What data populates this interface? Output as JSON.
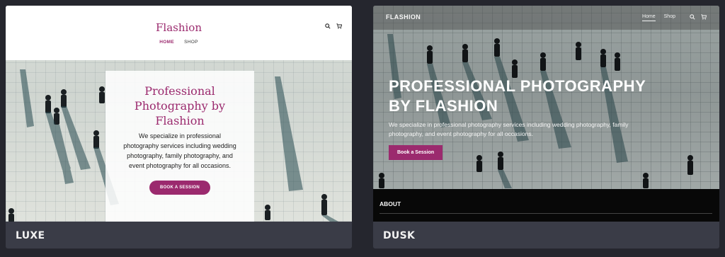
{
  "themes": [
    {
      "label": "LUXE",
      "brand": "Flashion",
      "nav": [
        "HOME",
        "SHOP"
      ],
      "hero_title": "Professional Photography by Flashion",
      "hero_text": "We specialize in professional photography services including wedding photography, family photography, and event photography for all occasions.",
      "cta": "BOOK A SESSION",
      "accent_color": "#9b2a6e",
      "icons": [
        "search-icon",
        "cart-icon"
      ]
    },
    {
      "label": "DUSK",
      "brand": "FLASHION",
      "nav": [
        "Home",
        "Shop"
      ],
      "hero_title": "PROFESSIONAL PHOTOGRAPHY BY FLASHION",
      "hero_text": "We specialize in professional photography services including wedding photography, family photography, and event photography for all occasions.",
      "cta": "Book a Session",
      "section_label": "ABOUT",
      "accent_color": "#9b2a6e",
      "icons": [
        "search-icon",
        "cart-icon"
      ]
    }
  ]
}
